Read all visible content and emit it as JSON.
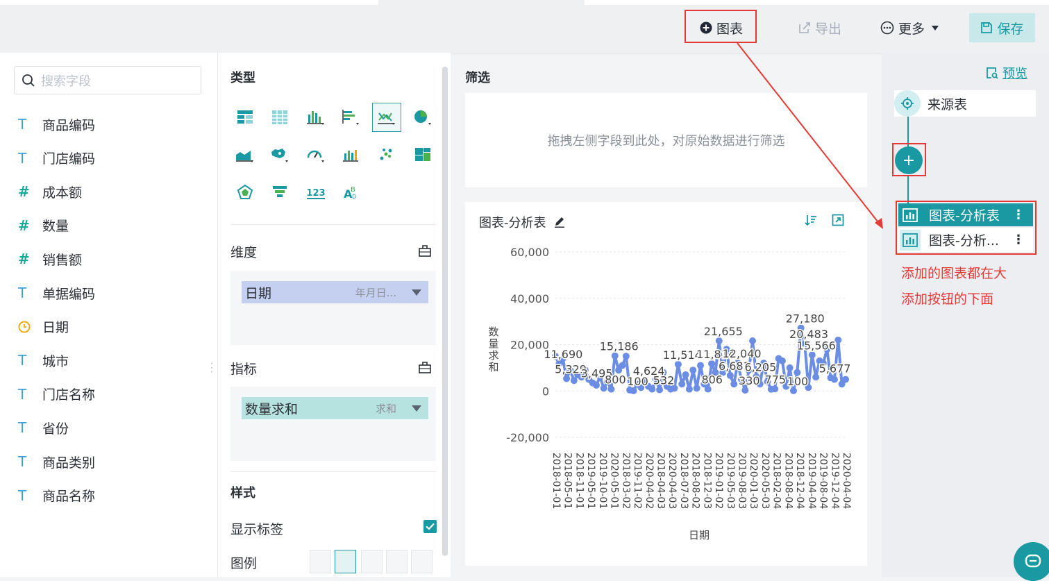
{
  "toolbar": {
    "add_chart": "图表",
    "export": "导出",
    "more": "更多",
    "save": "保存"
  },
  "fields": {
    "search_placeholder": "搜索字段",
    "items": [
      {
        "type": "T",
        "label": "商品编码"
      },
      {
        "type": "T",
        "label": "门店编码"
      },
      {
        "type": "#",
        "label": "成本额"
      },
      {
        "type": "#",
        "label": "数量"
      },
      {
        "type": "#",
        "label": "销售额"
      },
      {
        "type": "T",
        "label": "单据编码"
      },
      {
        "type": "date",
        "label": "日期"
      },
      {
        "type": "T",
        "label": "城市"
      },
      {
        "type": "T",
        "label": "门店名称"
      },
      {
        "type": "T",
        "label": "省份"
      },
      {
        "type": "T",
        "label": "商品类别"
      },
      {
        "type": "T",
        "label": "商品名称"
      }
    ]
  },
  "config": {
    "type_title": "类型",
    "dimension_title": "维度",
    "dimension_pill": {
      "label": "日期",
      "sub": "年月日..."
    },
    "measure_title": "指标",
    "measure_pill": {
      "label": "数量求和",
      "sub": "求和"
    },
    "style_title": "样式",
    "show_label": "显示标签",
    "legend": "图例",
    "colors": {
      "dimension_pill": "#c5cff0",
      "measure_pill": "#b6e2df",
      "accent": "#1a99a3"
    }
  },
  "filter": {
    "title": "筛选",
    "placeholder": "拖拽左侧字段到此处，对原始数据进行筛选"
  },
  "chart": {
    "title": "图表-分析表"
  },
  "chart_data": {
    "type": "line",
    "xlabel": "日期",
    "ylabel": "数量求和",
    "ylim": [
      -20000,
      60000
    ],
    "yticks": [
      "60,000",
      "40,000",
      "20,000",
      "0",
      "-20,000"
    ],
    "x_tick_labels": [
      "2018-01-01",
      "2018-05-01",
      "2018-11-01",
      "2019-05-01",
      "2019-10-01",
      "2020-05-01",
      "2018-03-02",
      "2019-11-02",
      "2020-04-02",
      "2018-04-03",
      "2020-04-03",
      "2018-07-03",
      "2018-08-02",
      "2018-12-03",
      "2019-01-02",
      "2019-05-03",
      "2019-08-03",
      "2020-01-03",
      "2020-05-03",
      "2018-02-04",
      "2018-08-04",
      "2018-12-04",
      "2019-04-04",
      "2019-08-04",
      "2019-12-04",
      "2020-04-04"
    ],
    "series": [
      {
        "values": [
          15000,
          11690,
          14000,
          5329,
          9000,
          4500,
          7000,
          6000,
          9000,
          5000,
          3495,
          2500,
          6000,
          1200,
          4000,
          800,
          15186,
          9000,
          11000,
          15000,
          400,
          100,
          3000,
          1500,
          4624,
          2000,
          800,
          5000,
          532,
          8000,
          2000,
          800,
          1200,
          11514,
          3000,
          7000,
          800,
          9000,
          1200,
          11000,
          3000,
          806,
          11814,
          8000,
          21655,
          8000,
          18000,
          6681,
          3000,
          12040,
          5000,
          330,
          9000,
          21655,
          6205,
          3000,
          12040,
          4000,
          775,
          900,
          14000,
          13000,
          2000,
          10000,
          100,
          8000,
          27180,
          20483,
          1500,
          15566,
          6000,
          13000,
          12000,
          18000,
          5677,
          5000,
          22000,
          3000,
          5000
        ]
      }
    ],
    "data_labels": [
      "11,690",
      "5,329",
      "3,495",
      "15,186",
      "100",
      "4,624",
      "532",
      "800",
      "806",
      "11,514",
      "11,814",
      "21,655",
      "6,681",
      "330",
      "12,040",
      "6,205",
      "775",
      "20,483",
      "100",
      "27,180",
      "15,566",
      "5,677"
    ],
    "grid": true,
    "point_color": "#6b8de3"
  },
  "right": {
    "preview": "预览",
    "source": "来源表",
    "add": "+",
    "nodes": [
      "图表-分析表",
      "图表-分析..."
    ],
    "annotation_line1": "添加的图表都在大",
    "annotation_line2": "添加按钮的下面"
  }
}
